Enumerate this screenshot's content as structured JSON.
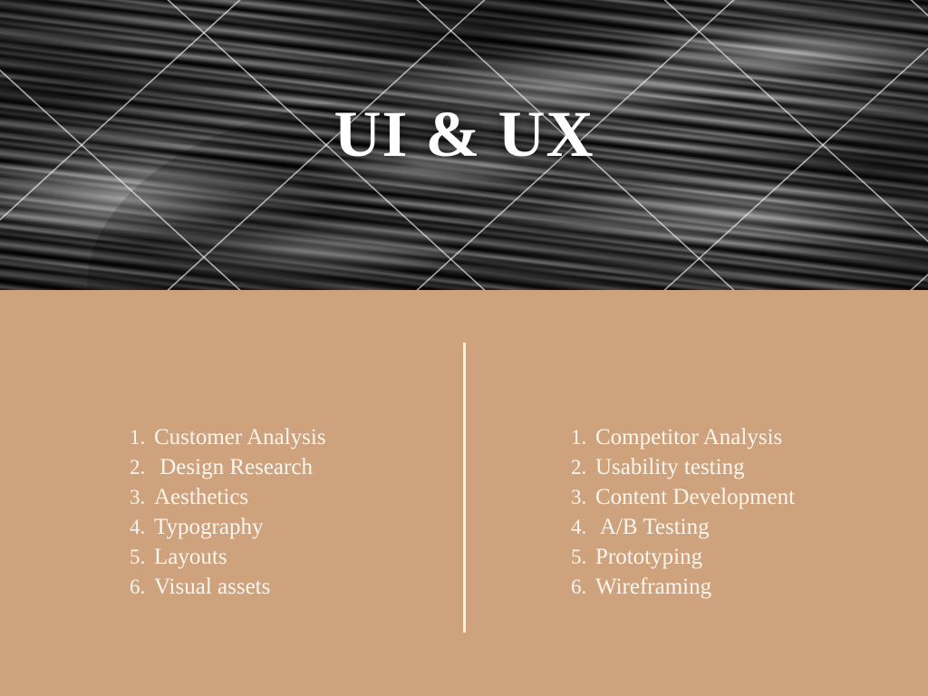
{
  "slide": {
    "title": "UI & UX",
    "background_color": "#CDA27D",
    "text_color": "#FAF5ED",
    "title_color": "#FFFFFF",
    "divider_color": "#F6F1E7",
    "header_image": "grayscale-marble-texture-photo",
    "header_overlay": "diagonal-crosshatch-lines"
  },
  "columns": {
    "left": {
      "items": [
        {
          "num": "1.",
          "text": "Customer Analysis"
        },
        {
          "num": "2.",
          "text": " Design Research"
        },
        {
          "num": "3.",
          "text": "Aesthetics"
        },
        {
          "num": "4.",
          "text": "Typography"
        },
        {
          "num": "5.",
          "text": "Layouts"
        },
        {
          "num": "6.",
          "text": "Visual assets"
        }
      ]
    },
    "right": {
      "items": [
        {
          "num": "1.",
          "text": "Competitor Analysis"
        },
        {
          "num": "2.",
          "text": "Usability testing"
        },
        {
          "num": "3.",
          "text": "Content Development"
        },
        {
          "num": "4.",
          "text": " A/B Testing"
        },
        {
          "num": "5.",
          "text": "Prototyping"
        },
        {
          "num": "6.",
          "text": "Wireframing"
        }
      ]
    }
  }
}
